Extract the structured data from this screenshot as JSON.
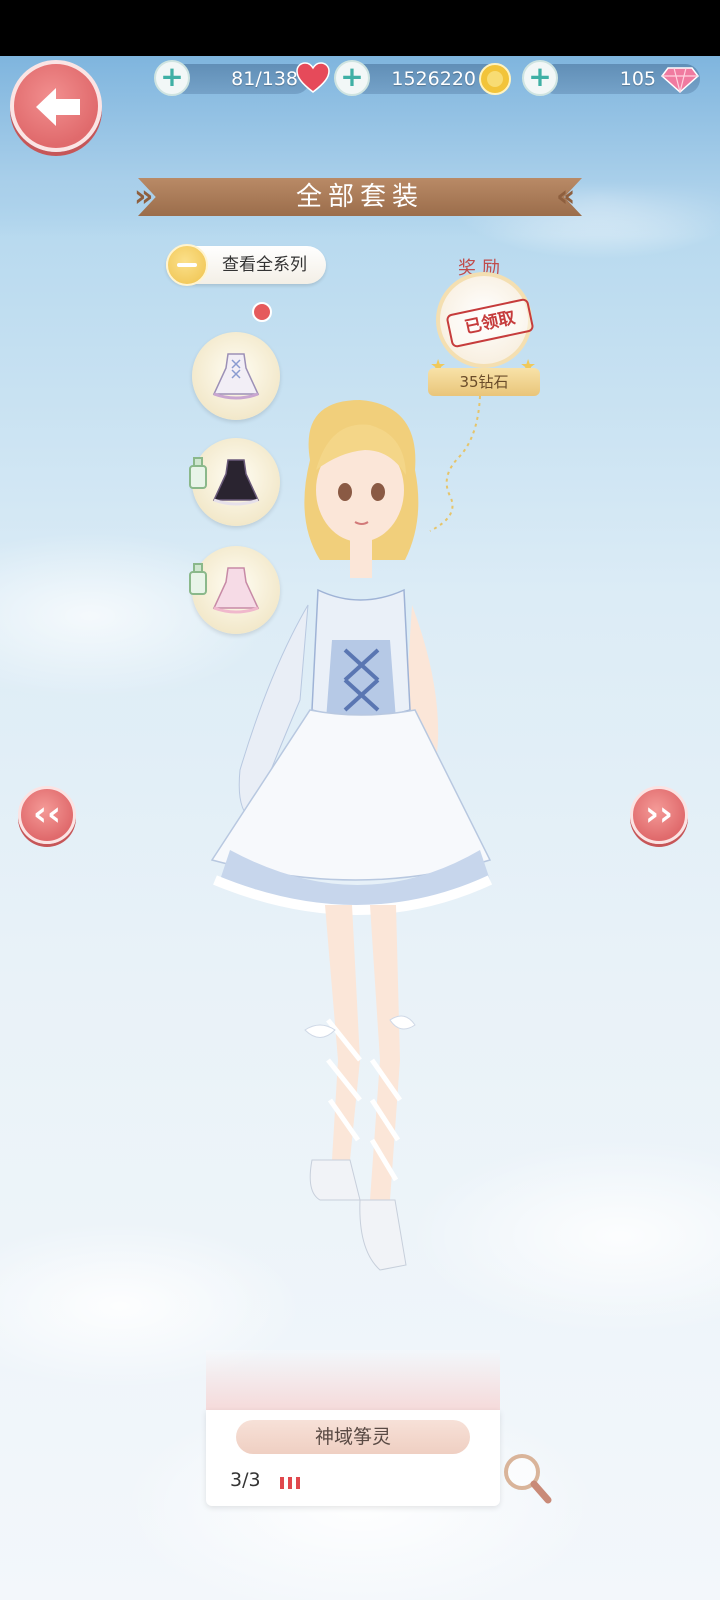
{
  "resources": {
    "stamina": "81/138",
    "coins": "1526220",
    "diamonds": "105"
  },
  "header": {
    "title": "全部套装"
  },
  "series_button": {
    "label": "查看全系列"
  },
  "reward": {
    "title": "奖励",
    "status": "已领取",
    "amount": "35钻石"
  },
  "suit": {
    "name": "神域筝灵",
    "progress": "3/3",
    "progress_fraction": 1.0
  },
  "colors": {
    "accent_red": "#e06a6c",
    "ribbon_brown": "#9b6d4b",
    "progress_red": "#e0484d"
  }
}
